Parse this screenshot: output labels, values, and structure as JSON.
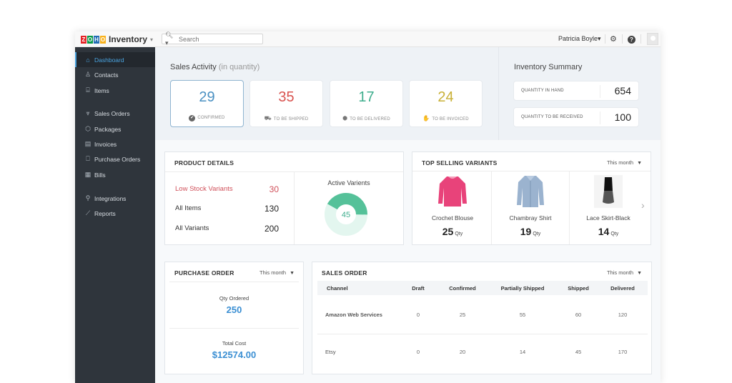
{
  "app": {
    "logo_letters": [
      "Z",
      "O",
      "H",
      "O"
    ],
    "logo_colors": [
      "#e42527",
      "#089949",
      "#226db4",
      "#f9b21d"
    ],
    "title": "Inventory",
    "caret": "▾"
  },
  "topbar": {
    "search_placeholder": "Search",
    "search_icon": "search-icon",
    "user_name": "Patricia Boyle",
    "user_caret": "▾",
    "settings_icon": "⚙",
    "help_icon": "?"
  },
  "sidebar": {
    "items": [
      {
        "label": "Dashboard",
        "icon": "⌂",
        "active": true
      },
      {
        "label": "Contacts",
        "icon": "♙"
      },
      {
        "label": "Items",
        "icon": "⌸"
      },
      {
        "label": "Sales Orders",
        "icon": "⩔"
      },
      {
        "label": "Packages",
        "icon": "⬡"
      },
      {
        "label": "Invoices",
        "icon": "▤"
      },
      {
        "label": "Purchase Orders",
        "icon": "⎕"
      },
      {
        "label": "Bills",
        "icon": "▦"
      },
      {
        "label": "Integrations",
        "icon": "⚲"
      },
      {
        "label": "Reports",
        "icon": "⟋"
      }
    ]
  },
  "sales_activity": {
    "title": "Sales Activity",
    "subtitle": "(in quantity)",
    "cards": [
      {
        "value": "29",
        "label": "CONFIRMED",
        "icon": "✔",
        "color": "#4a90c2"
      },
      {
        "value": "35",
        "label": "TO BE SHIPPED",
        "icon": "⛟",
        "color": "#d9534f"
      },
      {
        "value": "17",
        "label": "TO BE DELIVERED",
        "icon": "⬢",
        "color": "#3fae8e"
      },
      {
        "value": "24",
        "label": "TO BE INVOICED",
        "icon": "✋",
        "color": "#c9b036"
      }
    ]
  },
  "inventory_summary": {
    "title": "Inventory Summary",
    "rows": [
      {
        "label": "QUANTITY IN HAND",
        "value": "654"
      },
      {
        "label": "QUANTITY TO BE RECEIVED",
        "value": "100"
      }
    ]
  },
  "product_details": {
    "title": "PRODUCT DETAILS",
    "rows": [
      {
        "label": "Low Stock Variants",
        "value": "30"
      },
      {
        "label": "All Items",
        "value": "130"
      },
      {
        "label": "All Variants",
        "value": "200"
      }
    ],
    "active_variants": {
      "label": "Active Varients",
      "value": "45",
      "fraction": 0.42,
      "color": "#55c199",
      "track_color": "#e3f6ef"
    }
  },
  "top_selling": {
    "title": "TOP SELLING VARIANTS",
    "period": "This month",
    "qty_unit": "Qty",
    "items": [
      {
        "name": "Crochet Blouse",
        "qty": "25",
        "image": "pink-blouse"
      },
      {
        "name": "Chambray Shirt",
        "qty": "19",
        "image": "blue-shirt"
      },
      {
        "name": "Lace Skirt-Black",
        "qty": "14",
        "image": "black-skirt"
      }
    ],
    "next_icon": "›"
  },
  "purchase_order": {
    "title": "PURCHASE ORDER",
    "period": "This month",
    "qty_label": "Qty Ordered",
    "qty_value": "250",
    "cost_label": "Total Cost",
    "cost_value": "$12574.00"
  },
  "sales_order": {
    "title": "SALES ORDER",
    "period": "This month",
    "columns": [
      "Channel",
      "Draft",
      "Confirmed",
      "Partially Shipped",
      "Shipped",
      "Delivered"
    ],
    "rows": [
      [
        "Amazon Web Services",
        "0",
        "25",
        "55",
        "60",
        "120"
      ],
      [
        "Etsy",
        "0",
        "20",
        "14",
        "45",
        "170"
      ]
    ]
  }
}
